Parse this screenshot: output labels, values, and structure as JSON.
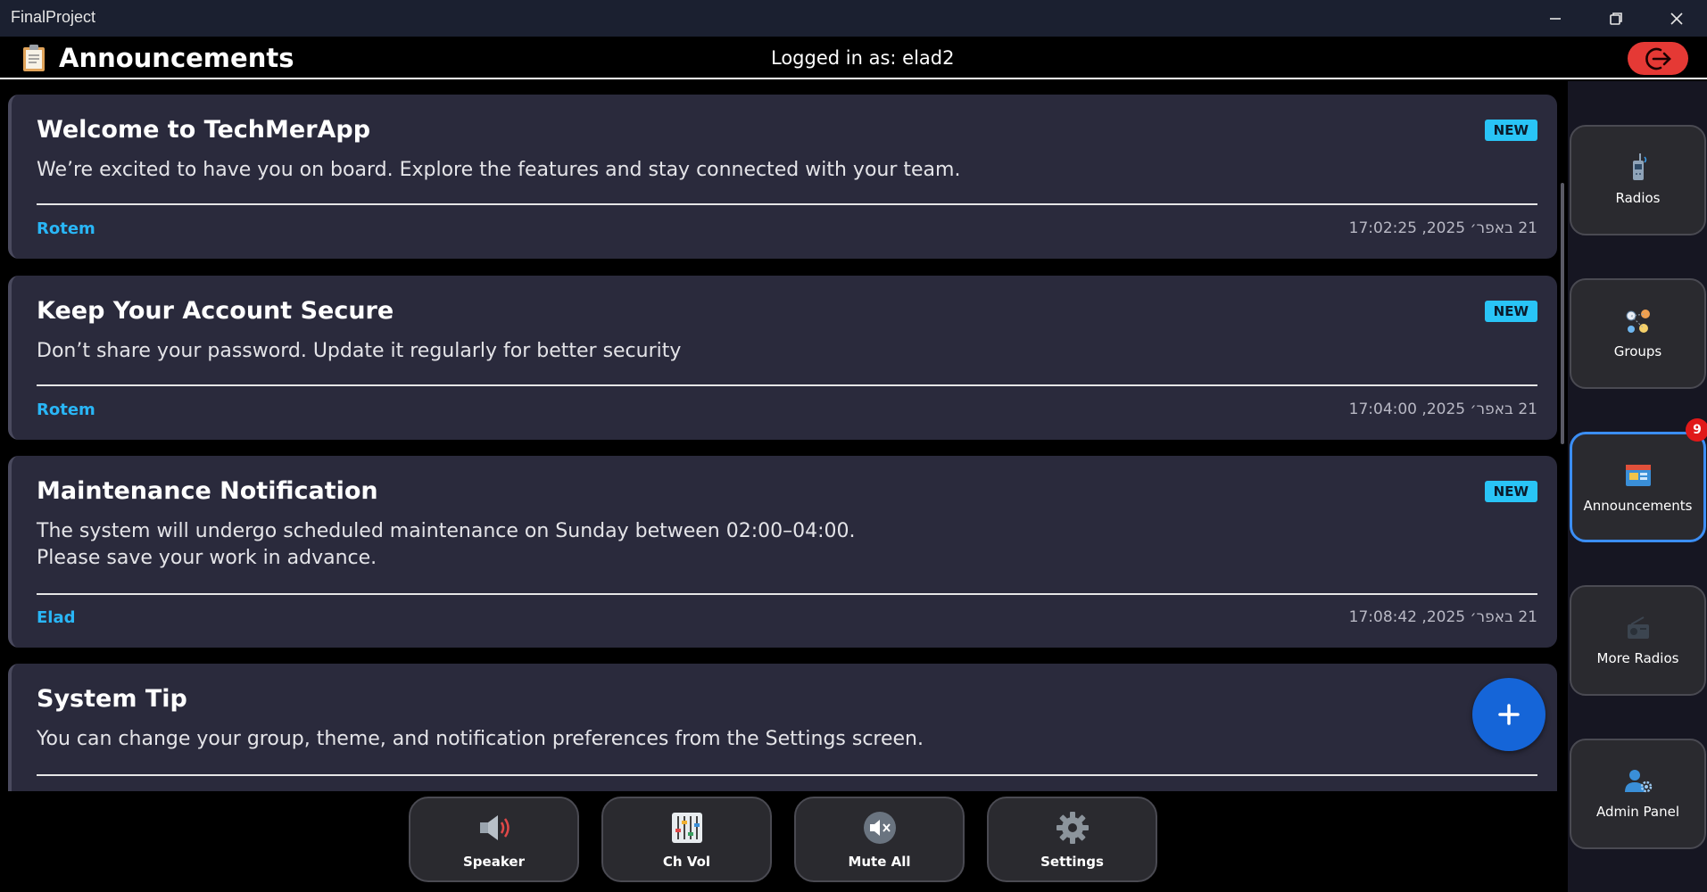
{
  "window": {
    "title": "FinalProject",
    "controls": [
      "minimize-icon",
      "restore-icon",
      "close-icon"
    ]
  },
  "header": {
    "title": "Announcements",
    "icon": "clipboard-icon",
    "login_status": "Logged in as: elad2",
    "logout_icon": "logout-icon",
    "logout_color": "#e53935"
  },
  "announcements": [
    {
      "title": "Welcome to TechMerApp",
      "body": "We’re excited to have you on board. Explore the features and stay connected with your team.",
      "badge": "NEW",
      "author": "Rotem",
      "timestamp": "21 באפר׳ 2025, 17:02:25"
    },
    {
      "title": "Keep Your Account Secure",
      "body": "Don’t share your password. Update it regularly for better security",
      "badge": "NEW",
      "author": "Rotem",
      "timestamp": "21 באפר׳ 2025, 17:04:00"
    },
    {
      "title": "Maintenance Notification",
      "body": "The system will undergo scheduled maintenance on Sunday between 02:00–04:00.\nPlease save your work in advance.",
      "badge": "NEW",
      "author": "Elad",
      "timestamp": "21 באפר׳ 2025, 17:08:42"
    },
    {
      "title": "System Tip",
      "body": "You can change your group, theme, and notification preferences from the Settings screen."
    }
  ],
  "fab": {
    "label": "+",
    "icon": "plus-icon"
  },
  "sidebar": {
    "items": [
      {
        "label": "Radios",
        "icon": "walkie-talkie-icon",
        "active": false
      },
      {
        "label": "Groups",
        "icon": "groups-icon",
        "active": false
      },
      {
        "label": "Announcements",
        "icon": "announcement-board-icon",
        "active": true,
        "badge": "9"
      },
      {
        "label": "More Radios",
        "icon": "radio-icon",
        "active": false
      },
      {
        "label": "Admin Panel",
        "icon": "admin-user-gear-icon",
        "active": false
      }
    ]
  },
  "bottom_bar": {
    "items": [
      {
        "label": "Speaker",
        "icon": "speaker-icon"
      },
      {
        "label": "Ch Vol",
        "icon": "mixer-icon"
      },
      {
        "label": "Mute All",
        "icon": "mute-icon"
      },
      {
        "label": "Settings",
        "icon": "gear-icon"
      }
    ]
  },
  "colors": {
    "card_background": "#2a2a3c",
    "new_badge": "#29c4f6",
    "author": "#29b6f6",
    "active_border": "#3b8ef5",
    "fab": "#1565d8",
    "notification_badge": "#e01919"
  }
}
